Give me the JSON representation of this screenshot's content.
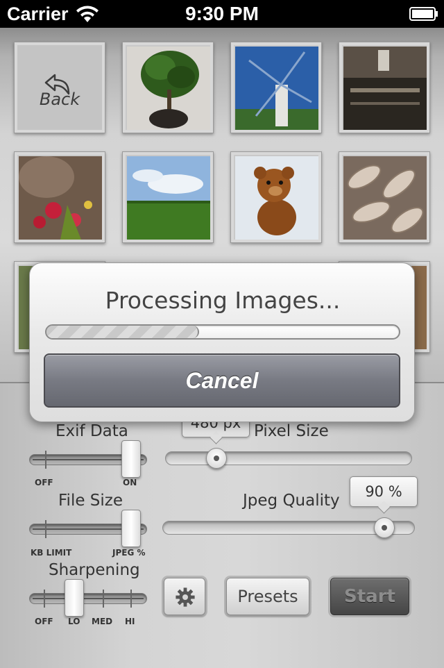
{
  "status_bar": {
    "carrier": "Carrier",
    "time": "9:30 PM"
  },
  "gallery": {
    "back_label": "Back",
    "thumbnails": [
      {
        "subject": "potted tree"
      },
      {
        "subject": "windmill"
      },
      {
        "subject": "interior"
      },
      {
        "subject": "flowers"
      },
      {
        "subject": "green field"
      },
      {
        "subject": "teddy bear"
      },
      {
        "subject": "knitted texture"
      }
    ]
  },
  "controls": {
    "exif": {
      "label": "Exif Data",
      "min_label": "OFF",
      "max_label": "ON",
      "value": "ON"
    },
    "pixel_size": {
      "label": "Pixel Size",
      "bubble": "480 px"
    },
    "file_size": {
      "label": "File Size",
      "min_label": "KB LIMIT",
      "max_label": "JPEG %",
      "value": "JPEG %"
    },
    "jpeg_quality": {
      "label": "Jpeg Quality",
      "bubble": "90 %",
      "percent": 90
    },
    "sharpening": {
      "label": "Sharpening",
      "ticks": [
        "OFF",
        "LO",
        "MED",
        "HI"
      ],
      "value": "LO"
    },
    "settings_icon": "gear-icon",
    "presets_label": "Presets",
    "start_label": "Start"
  },
  "alert": {
    "title": "Processing Images...",
    "progress": 0.43,
    "cancel_label": "Cancel"
  },
  "colors": {
    "cancel_button": "#7a7c85",
    "start_button": "#555555",
    "status_bar": "#000000"
  }
}
